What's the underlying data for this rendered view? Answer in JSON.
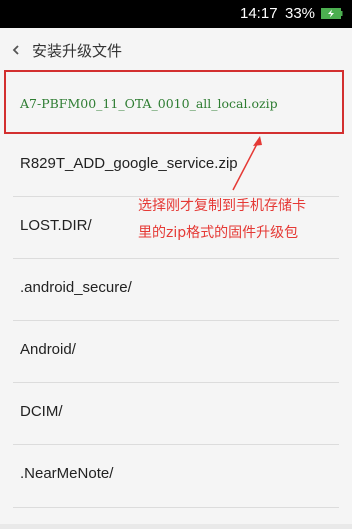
{
  "status_bar": {
    "time": "14:17",
    "battery_percent": "33%",
    "battery_color": "#4caf50"
  },
  "header": {
    "back_icon": "chevron-left-icon",
    "title": "安装升级文件"
  },
  "files": [
    {
      "name": "A7-PBFM00_11_OTA_0010_all_local.ozip",
      "highlighted": true
    },
    {
      "name": "R829T_ADD_google_service.zip"
    },
    {
      "name": "LOST.DIR/"
    },
    {
      "name": ".android_secure/"
    },
    {
      "name": "Android/"
    },
    {
      "name": "DCIM/"
    },
    {
      "name": ".NearMeNote/"
    }
  ],
  "annotation": {
    "line1": "选择刚才复制到手机存储卡",
    "line2": "里的zip格式的固件升级包",
    "color": "#e53935"
  },
  "highlight_color": "#d32f2f",
  "highlight_text_color": "#2e7d32"
}
